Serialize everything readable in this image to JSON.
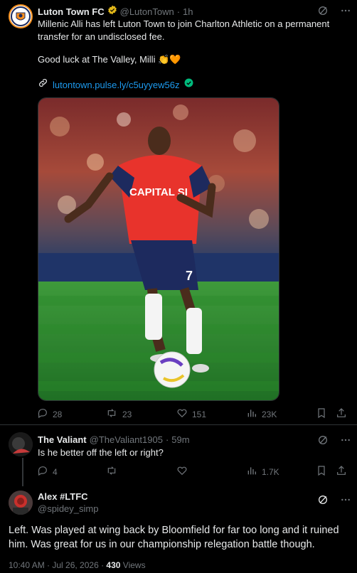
{
  "post1": {
    "display_name": "Luton Town FC",
    "handle": "@LutonTown",
    "separator": "·",
    "time": "1h",
    "text_line1": "Millenic Alli has left Luton Town to join Charlton Athletic on a permanent",
    "text_line2": "transfer for an undisclosed fee.",
    "text_line3": "Good luck at The Valley, Milli 👏🧡",
    "link": "lutontown.pulse.ly/c5uyyew56z",
    "shirt_text": "CAPITAL SI",
    "shirt_number": "7",
    "stats": {
      "replies": "28",
      "reposts": "23",
      "likes": "151",
      "views": "23K"
    }
  },
  "post2": {
    "display_name": "The Valiant",
    "handle": "@TheValiant1905",
    "separator": "·",
    "time": "59m",
    "text": "Is he better off the left or right?",
    "stats": {
      "replies": "4",
      "views": "1.7K"
    }
  },
  "post3": {
    "display_name": "Alex #LTFC",
    "handle": "@spidey_simp",
    "text_line1": "Left. Was played at wing back by Bloomfield for far too long and it ruined",
    "text_line2": "him. Was great for us in our championship relegation battle though.",
    "timestamp": "10:40 AM · Jul 26, 2026 · ",
    "views_count": "430",
    "views_label": " Views"
  },
  "colors": {
    "accent": "#1d9bf0",
    "muted": "#71767b",
    "text": "#e7e9ea",
    "verified_gold": "#e2b719",
    "luton_orange": "#f78f1e"
  },
  "icons": [
    "luton-badge-icon",
    "verified-gold-icon",
    "grok-icon",
    "more-icon",
    "link-icon",
    "verified-green-icon",
    "reply-icon",
    "repost-icon",
    "like-icon",
    "views-icon",
    "bookmark-icon",
    "share-icon"
  ]
}
